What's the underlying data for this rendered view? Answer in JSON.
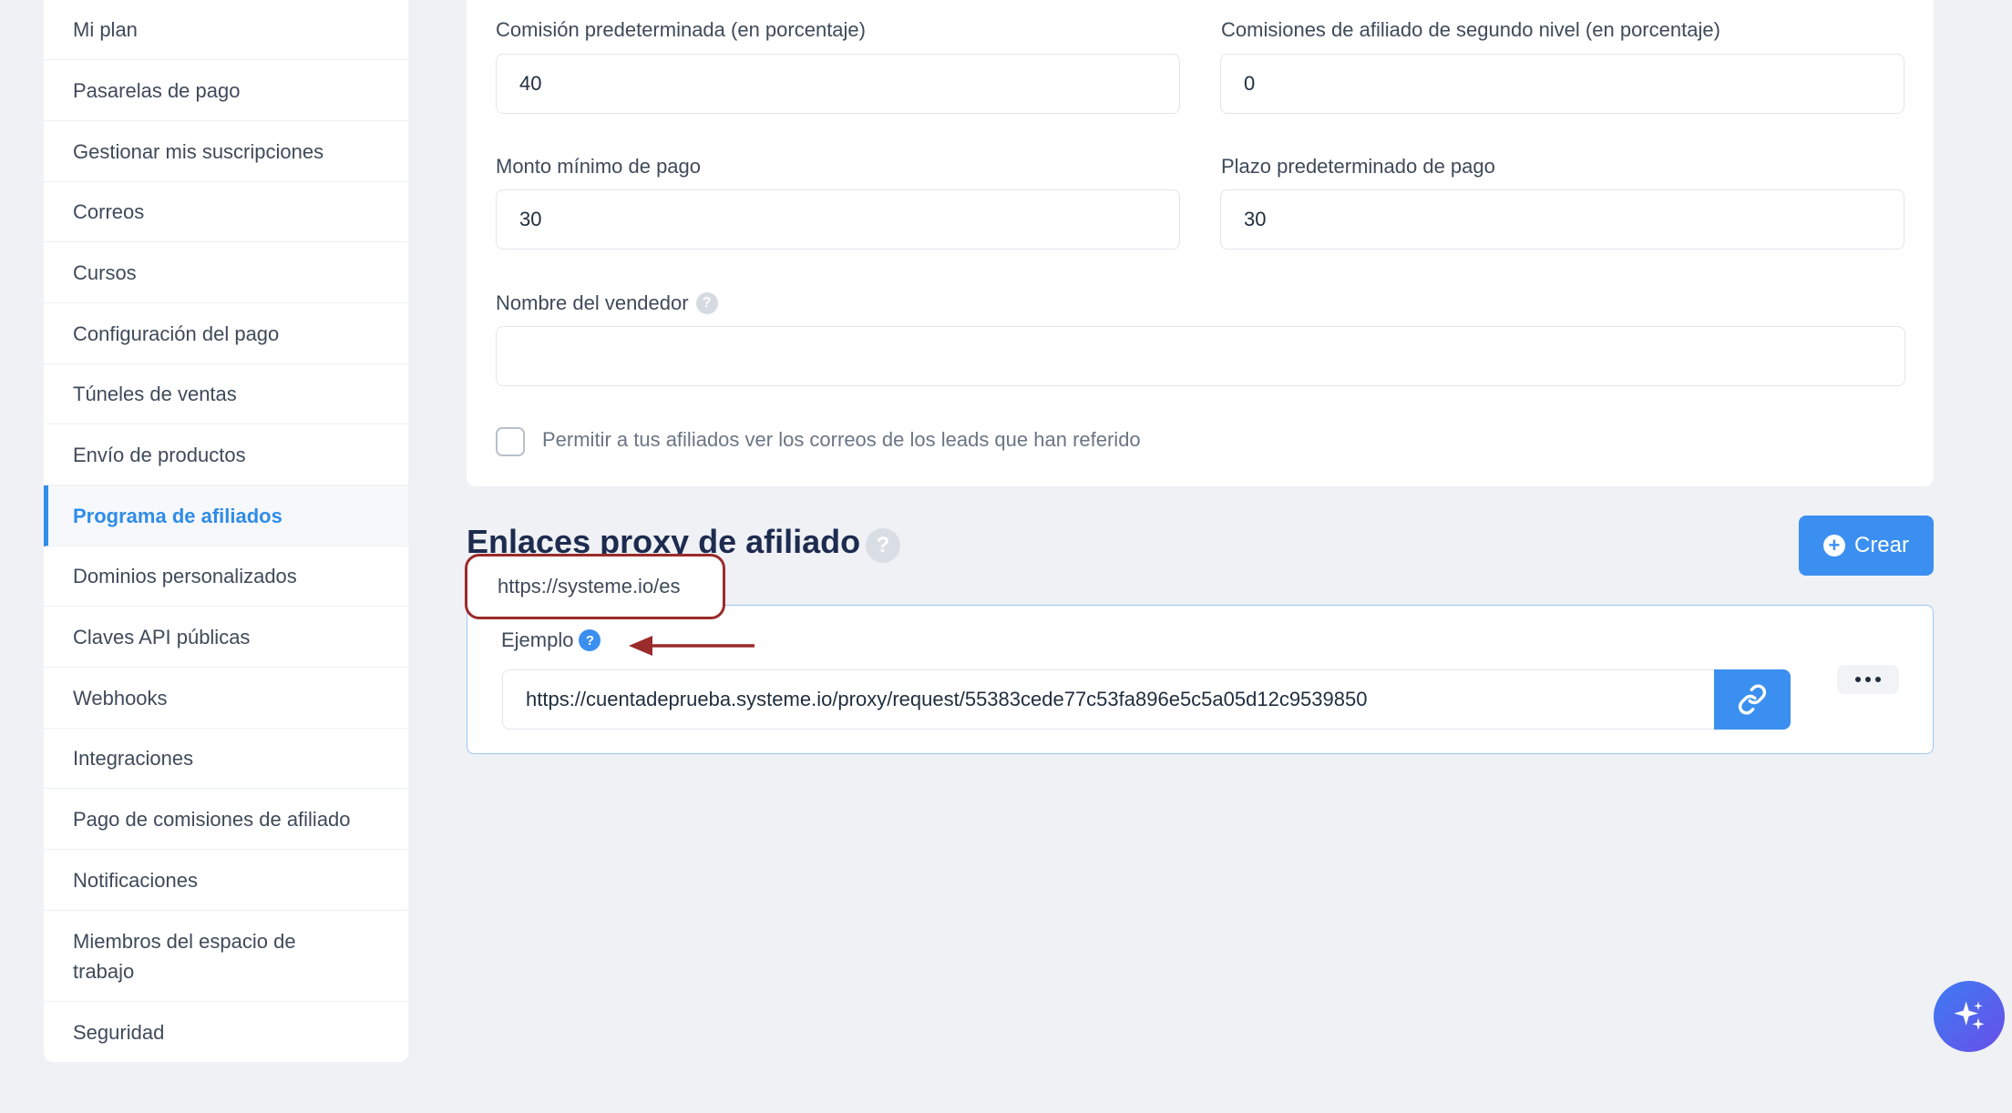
{
  "sidebar": {
    "items": [
      {
        "label": "Mi plan"
      },
      {
        "label": "Pasarelas de pago"
      },
      {
        "label": "Gestionar mis suscripciones"
      },
      {
        "label": "Correos"
      },
      {
        "label": "Cursos"
      },
      {
        "label": "Configuración del pago"
      },
      {
        "label": "Túneles de ventas"
      },
      {
        "label": "Envío de productos"
      },
      {
        "label": "Programa de afiliados",
        "active": true
      },
      {
        "label": "Dominios personalizados"
      },
      {
        "label": "Claves API públicas"
      },
      {
        "label": "Webhooks"
      },
      {
        "label": "Integraciones"
      },
      {
        "label": "Pago de comisiones de afiliado"
      },
      {
        "label": "Notificaciones"
      },
      {
        "label": "Miembros del espacio de trabajo"
      },
      {
        "label": "Seguridad"
      }
    ]
  },
  "settings": {
    "default_commission": {
      "label": "Comisión predeterminada (en porcentaje)",
      "value": "40"
    },
    "second_tier_commission": {
      "label": "Comisiones de afiliado de segundo nivel (en porcentaje)",
      "value": "0"
    },
    "min_payout": {
      "label": "Monto mínimo de pago",
      "value": "30"
    },
    "payout_term": {
      "label": "Plazo predeterminado de pago",
      "value": "30"
    },
    "seller_name": {
      "label": "Nombre del vendedor",
      "value": ""
    },
    "allow_view_emails": {
      "label": "Permitir a tus afiliados ver los correos de los leads que han referido",
      "checked": false
    }
  },
  "proxy_links": {
    "title": "Enlaces proxy de afiliado",
    "create_label": "Crear",
    "callout_text": "https://systeme.io/es",
    "example_label": "Ejemplo",
    "example_url": "https://cuentadeprueba.systeme.io/proxy/request/55383cede77c53fa896e5c5a05d12c9539850"
  },
  "colors": {
    "accent": "#3b8ff0",
    "heading": "#1d2b4f",
    "callout_border": "#9b2a2a"
  },
  "icons": {
    "help": "?",
    "plus": "+"
  }
}
